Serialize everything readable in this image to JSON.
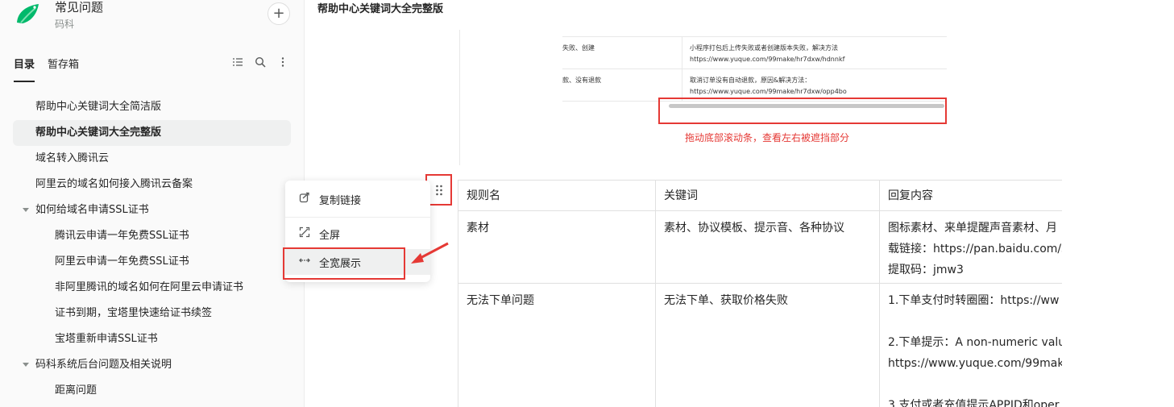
{
  "book": {
    "title": "常见问题",
    "subtitle": "码科"
  },
  "sidebar": {
    "add_label": "+",
    "tabs": [
      {
        "label": "目录"
      },
      {
        "label": "暂存箱"
      }
    ],
    "tree": [
      {
        "label": "帮助中心关键词大全简洁版",
        "level": 0,
        "active": false
      },
      {
        "label": "帮助中心关键词大全完整版",
        "level": 0,
        "active": true
      },
      {
        "label": "域名转入腾讯云",
        "level": 0,
        "active": false
      },
      {
        "label": "阿里云的域名如何接入腾讯云备案",
        "level": 0,
        "active": false
      },
      {
        "label": "如何给域名申请SSL证书",
        "level": 0,
        "expanded": true
      },
      {
        "label": "腾讯云申请一年免费SSL证书",
        "level": 1
      },
      {
        "label": "阿里云申请一年免费SSL证书",
        "level": 1
      },
      {
        "label": "非阿里腾讯的域名如何在阿里云申请证书",
        "level": 1
      },
      {
        "label": "证书到期，宝塔里快速给证书续签",
        "level": 1
      },
      {
        "label": "宝塔重新申请SSL证书",
        "level": 1
      },
      {
        "label": "码科系统后台问题及相关说明",
        "level": 0,
        "expanded": true
      },
      {
        "label": "距离问题",
        "level": 1
      }
    ]
  },
  "doc": {
    "title": "帮助中心关键词大全完整版",
    "screenshot": {
      "rows": [
        {
          "a": "失败、创建",
          "b1": "小程序打包后上传失败或者创建版本失败，解决方法",
          "b2": "https://www.yuque.com/99make/hr7dxw/hdnnkf"
        },
        {
          "a": "款、没有退款",
          "b1": "取消订单没有自动退款，原因&解决方法：",
          "b2": "https://www.yuque.com/99make/hr7dxw/opp4bo"
        }
      ],
      "note": "拖动底部滚动条，查看左右被遮挡部分"
    },
    "menu": {
      "items": [
        {
          "label": "复制链接",
          "icon": "link-icon"
        },
        {
          "label": "全屏",
          "icon": "fullscreen-icon"
        },
        {
          "label": "全宽展示",
          "icon": "full-width-icon"
        }
      ]
    },
    "table": {
      "headers": [
        "规则名",
        "关键词",
        "回复内容"
      ],
      "rows": [
        {
          "c0": [
            "素材"
          ],
          "c1": [
            "素材、协议模板、提示音、各种协议"
          ],
          "c2": [
            "图标素材、来单提醒声音素材、月",
            "载链接：https://pan.baidu.com/s",
            "提取码：jmw3"
          ]
        },
        {
          "c0": [
            "无法下单问题"
          ],
          "c1": [
            "无法下单、获取价格失败"
          ],
          "c2": [
            "1.下单支付时转圈圈：https://ww",
            "",
            "2.下单提示：A non-numeric valu",
            "https://www.yuque.com/99make/",
            "",
            "3.支付或者充值提示APPID和oper"
          ]
        }
      ]
    }
  },
  "colors": {
    "accent": "#e53935",
    "active_bg": "#eff0f0",
    "logo_green": "#00b96b"
  }
}
